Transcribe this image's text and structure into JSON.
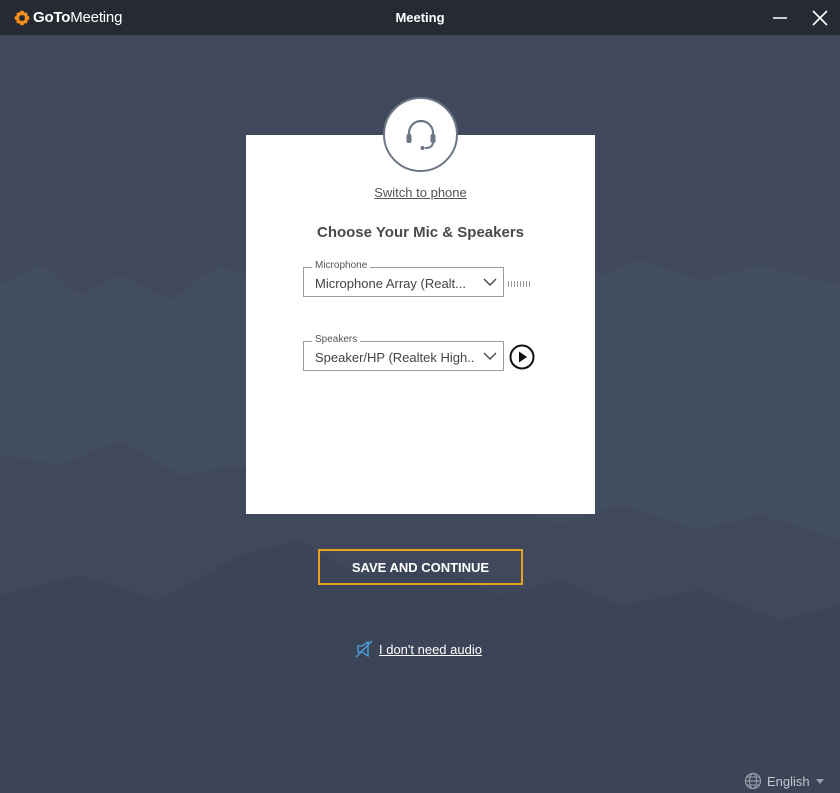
{
  "titlebar": {
    "logo_bold": "GoTo",
    "logo_regular": "Meeting",
    "title": "Meeting",
    "minimize_icon": "minimize-icon",
    "close_icon": "close-icon"
  },
  "card": {
    "headset_icon": "headset-icon",
    "switch_link": "Switch to phone",
    "heading": "Choose Your Mic & Speakers",
    "microphone": {
      "label": "Microphone",
      "value": "Microphone Array (Realt..."
    },
    "speakers": {
      "label": "Speakers",
      "value": "Speaker/HP (Realtek High..."
    }
  },
  "save_button": "SAVE AND CONTINUE",
  "no_audio_link": "I don't need audio",
  "language": "English",
  "colors": {
    "background": "#404a5c",
    "titlebar": "#262b33",
    "accent_orange": "#e8a21b",
    "link_blue": "#4aa3df"
  }
}
